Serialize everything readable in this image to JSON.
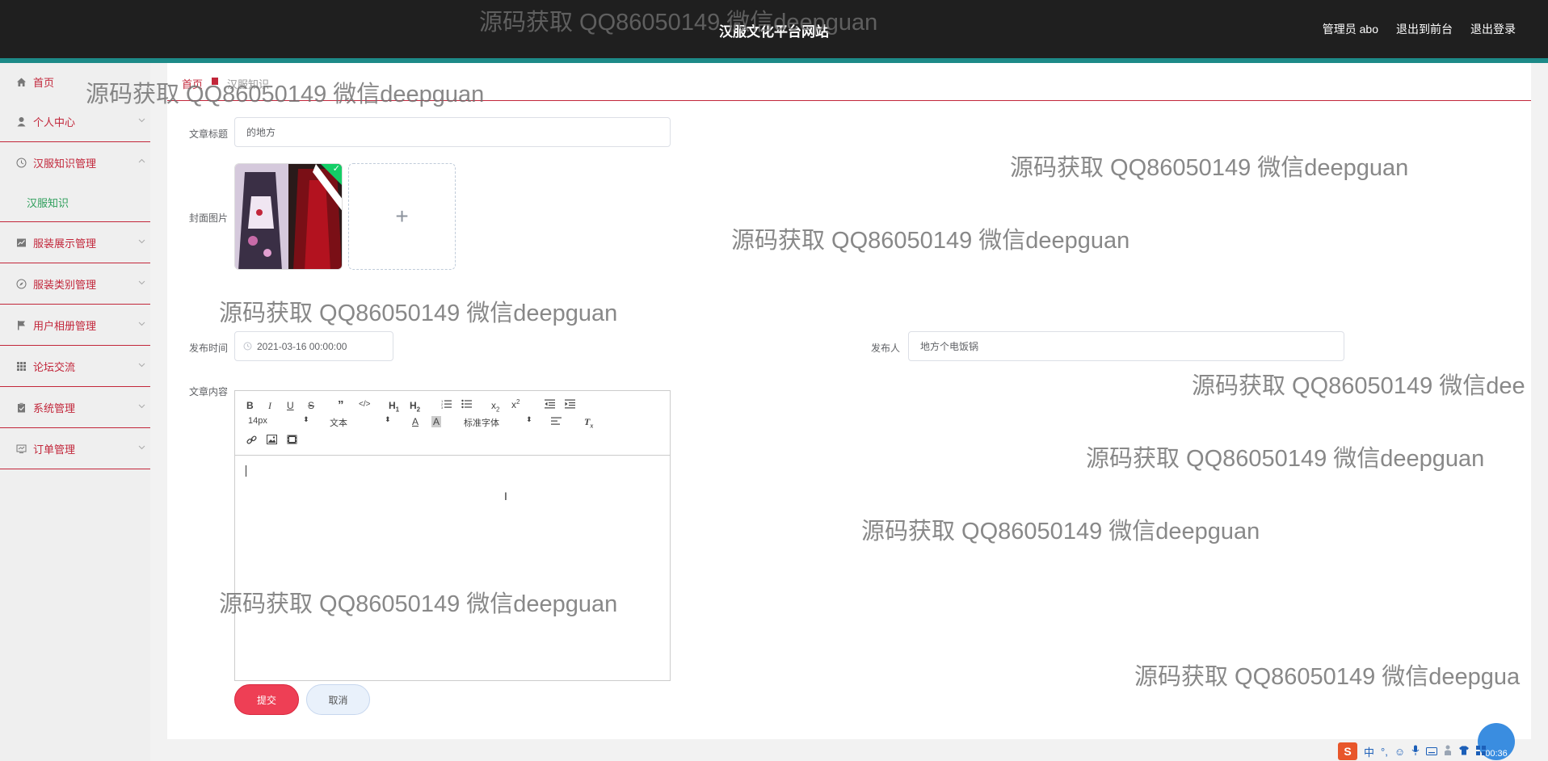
{
  "header": {
    "site_title": "汉服文化平台网站",
    "admin_label": "管理员 abo",
    "back_to_front": "退出到前台",
    "logout": "退出登录"
  },
  "sidebar": {
    "items": [
      {
        "label": "首页",
        "icon": "home-icon"
      },
      {
        "label": "个人中心",
        "icon": "user-icon"
      },
      {
        "label": "汉服知识管理",
        "icon": "clock-icon"
      },
      {
        "label": "服装展示管理",
        "icon": "chart-icon"
      },
      {
        "label": "服装类别管理",
        "icon": "compass-icon"
      },
      {
        "label": "用户相册管理",
        "icon": "flag-icon"
      },
      {
        "label": "论坛交流",
        "icon": "grid-icon"
      },
      {
        "label": "系统管理",
        "icon": "clipboard-icon"
      },
      {
        "label": "订单管理",
        "icon": "screen-icon"
      }
    ],
    "active_submenu": "汉服知识"
  },
  "breadcrumb": {
    "home": "首页",
    "current": "汉服知识"
  },
  "form": {
    "title_label": "文章标题",
    "title_value": "的地方",
    "cover_label": "封面图片",
    "publish_time_label": "发布时间",
    "publish_time_value": "2021-03-16 00:00:00",
    "publisher_label": "发布人",
    "publisher_value": "地方个电饭锅",
    "content_label": "文章内容",
    "submit": "提交",
    "cancel": "取消"
  },
  "editor": {
    "font_size": "14px",
    "paragraph": "文本",
    "font_family": "标准字体"
  },
  "watermark": "源码获取 QQ86050149 微信deepguan",
  "watermark_cut_1": "源码获取 QQ86050149 微信dee",
  "watermark_cut_2": "源码获取 QQ86050149 微信deepgua",
  "taskbar": {
    "ime_logo": "S",
    "ime_lang": "中",
    "timer": "00:36"
  }
}
